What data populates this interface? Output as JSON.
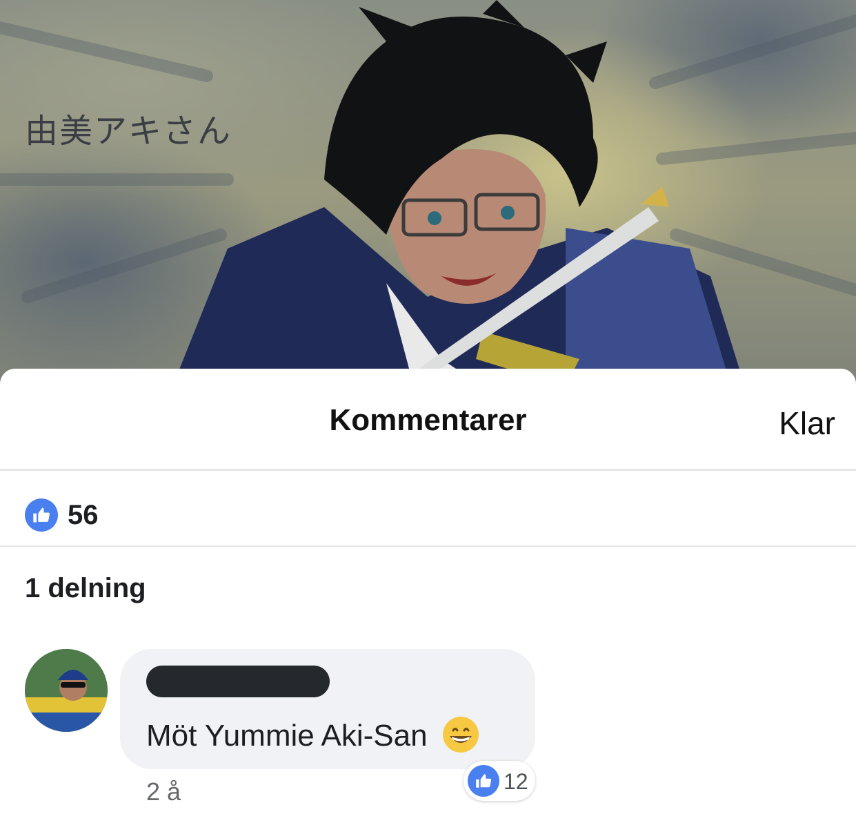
{
  "hero": {
    "caption": "由美アキさん"
  },
  "sheet": {
    "title": "Kommentarer",
    "done_label": "Klar"
  },
  "likes": {
    "icon": "like-icon",
    "count": "56",
    "accent": "#4a7ff0"
  },
  "shares": {
    "label": "1 delning"
  },
  "comment": {
    "text": "Möt Yummie Aki-San",
    "emoji": "grinning-face-icon",
    "time": "2 å",
    "reaction_count": "12"
  }
}
